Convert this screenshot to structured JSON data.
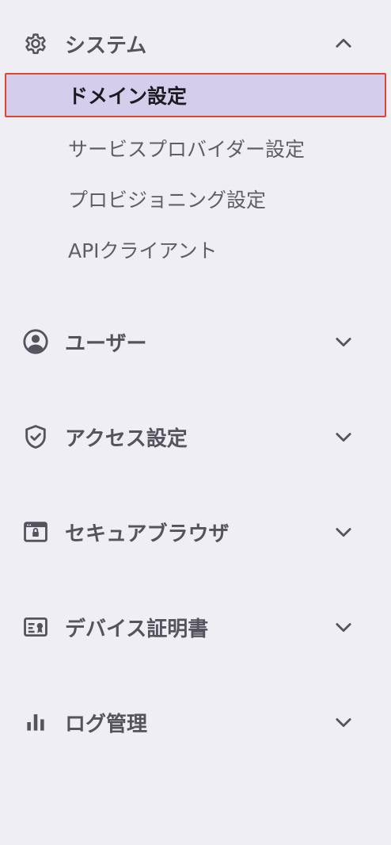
{
  "sidebar": {
    "sections": [
      {
        "label": "システム",
        "icon": "gear-icon",
        "expanded": true,
        "items": [
          {
            "label": "ドメイン設定",
            "selected": true
          },
          {
            "label": "サービスプロバイダー設定",
            "selected": false
          },
          {
            "label": "プロビジョニング設定",
            "selected": false
          },
          {
            "label": "APIクライアント",
            "selected": false
          }
        ]
      },
      {
        "label": "ユーザー",
        "icon": "user-circle-icon",
        "expanded": false
      },
      {
        "label": "アクセス設定",
        "icon": "shield-check-icon",
        "expanded": false
      },
      {
        "label": "セキュアブラウザ",
        "icon": "browser-lock-icon",
        "expanded": false
      },
      {
        "label": "デバイス証明書",
        "icon": "certificate-icon",
        "expanded": false
      },
      {
        "label": "ログ管理",
        "icon": "bar-chart-icon",
        "expanded": false
      }
    ]
  },
  "colors": {
    "background": "#efeef4",
    "text": "#55535d",
    "selected_bg": "#d5cdec",
    "selected_border": "#d9472f",
    "selected_text": "#1d1b22"
  }
}
